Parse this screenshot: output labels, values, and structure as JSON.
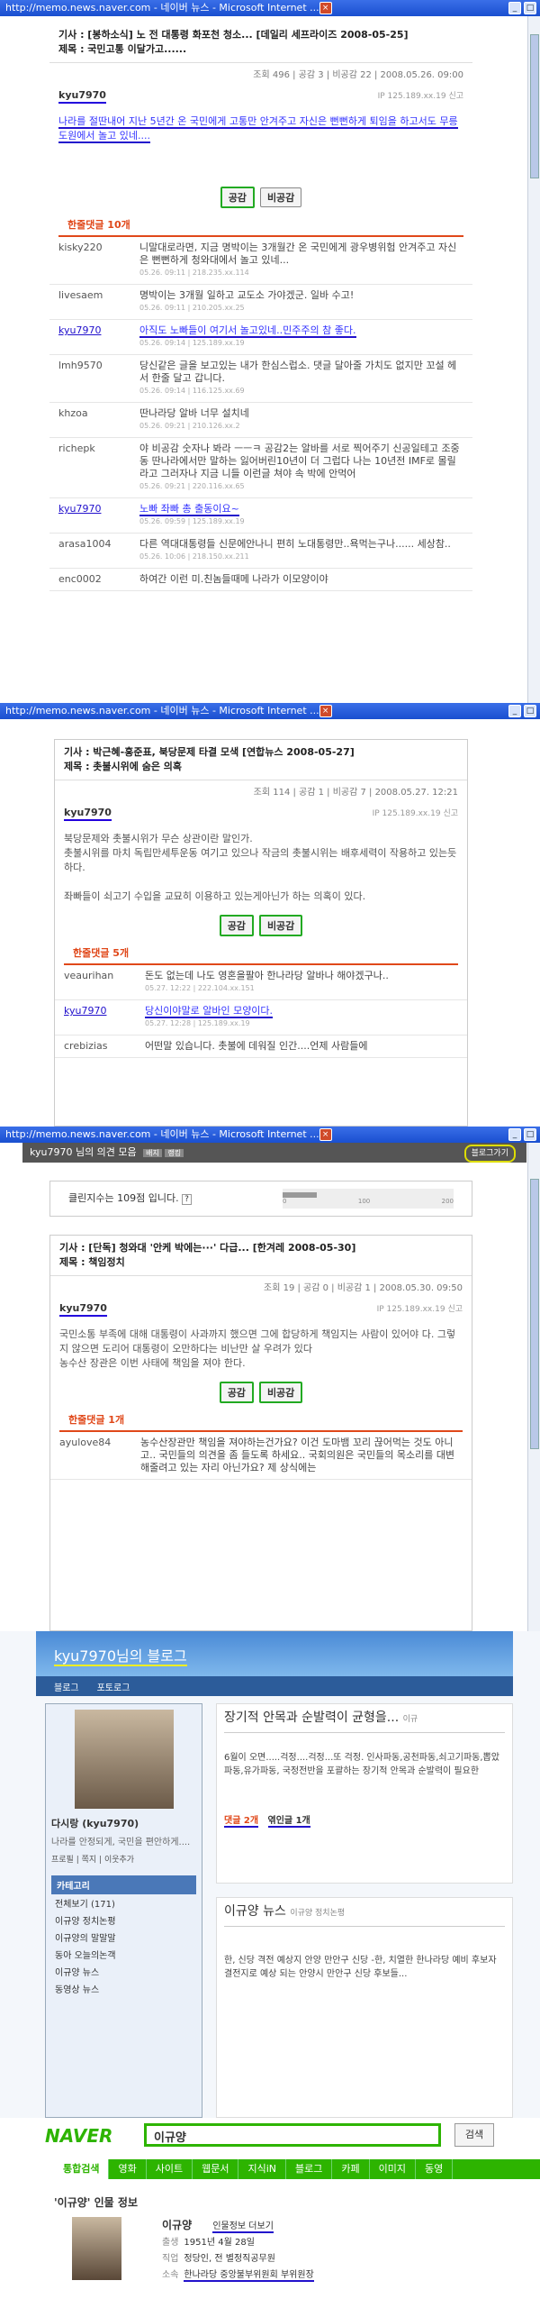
{
  "win1": {
    "title": "http://memo.news.naver.com - 네이버 뉴스 - Microsoft Internet ...",
    "article": "기사 : [봉하소식] 노 전 대통령 화포천 청소... [데일리 세프라이즈 2008-05-25]",
    "subject": "제목 : 국민고통 이달가고......",
    "stats": "조회 496 | 공감 3 | 비공감 22 | 2008.05.26. 09:00",
    "author": "kyu7970",
    "ip": "IP 125.189.xx.19",
    "report": "신고",
    "body": "나라를 절딴내어 지난 5년간 온 국민에게 고통만 안겨주고 자신은 뻔뻔하게 퇴임을 하고서도 무릉도원에서 놀고 있네....",
    "agree": "공감",
    "disagree": "비공감",
    "reply_head": "한줄댓글 10개",
    "replies": [
      {
        "nick": "kisky220",
        "text": "니말대로라면, 지금 명박이는 3개월간 온 국민에게 광우병위험 안겨주고 자신은 뻔뻔하게 청와대에서 놀고 있네...",
        "sub": "05.26. 09:11 | 218.235.xx.114"
      },
      {
        "nick": "livesaem",
        "text": "명박이는 3개월 일하고 교도소 가야겠군. 일바 수고!",
        "sub": "05.26. 09:11 | 210.205.xx.25"
      },
      {
        "nick": "kyu7970",
        "text": "아직도 노빠들이 여기서 놀고있네..민주주의 참 좋다.",
        "sub": "05.26. 09:14 | 125.189.xx.19"
      },
      {
        "nick": "lmh9570",
        "text": "당신같은 글을 보고있는 내가 한심스럽소. 댓글 달아줄 가치도 없지만 꼬설 헤서 한줄 달고 갑니다.",
        "sub": "05.26. 09:14 | 116.125.xx.69"
      },
      {
        "nick": "khzoa",
        "text": "딴나라당 알바 너무 설치네",
        "sub": "05.26. 09:21 | 210.126.xx.2"
      },
      {
        "nick": "richepk",
        "text": "야 비공감 숫자나 봐라 ㅡㅡㅋ 공감2는 알바를 서로 찍어주기 신공일테고 조중동 딴나라에서만 말하는 잃어버린10년이 더 그럽다 나는 10년전 IMF로 몰릴라고 그러자나 지금 니들 이런글 쳐야 속 박에 안먹어",
        "sub": "05.26. 09:21 | 220.116.xx.65"
      },
      {
        "nick": "kyu7970",
        "text": "노빠 좌빠 총 출동이요~",
        "sub": "05.26. 09:59 | 125.189.xx.19"
      },
      {
        "nick": "arasa1004",
        "text": "다른 역대대통령들 신문에안나니 편히 노대통령만..욕먹는구나...... 세상참..",
        "sub": "05.26. 10:06 | 218.150.xx.211"
      },
      {
        "nick": "enc0002",
        "text": "하여간 이런 미.친놈들때메 나라가 이모양이야",
        "sub": ""
      }
    ]
  },
  "win2": {
    "title": "http://memo.news.naver.com - 네이버 뉴스 - Microsoft Internet ...",
    "article": "기사 : 박근혜-홍준표, 북당문제 타결 모색 [연합뉴스 2008-05-27]",
    "subject": "제목 : 촛불시위에 숨은 의혹",
    "stats": "조회 114 | 공감 1 | 비공감 7 | 2008.05.27. 12:21",
    "author": "kyu7970",
    "ip": "IP 125.189.xx.19",
    "report": "신고",
    "body1": "북당문제와 촛불시위가 무슨 상관이란 말인가.",
    "body2": "촛불시위를 마치 독립만세투운동 여기고 있으나 작금의 촛불시위는 배후세력이 작용하고 있는듯하다.",
    "body3": "좌빠들이 쇠고기 수입을 교묘히 이용하고 있는게아닌가 하는 의혹이 있다.",
    "agree": "공감",
    "disagree": "비공감",
    "reply_head": "한줄댓글 5개",
    "replies": [
      {
        "nick": "veaurihan",
        "text": "돈도 없는데 나도 영혼을팔아 한나라당 알바나 해야겠구나..",
        "sub": "05.27. 12:22 | 222.104.xx.151"
      },
      {
        "nick": "kyu7970",
        "text": "당신이야말로 알바인 모양이다.",
        "sub": "05.27. 12:28 | 125.189.xx.19"
      },
      {
        "nick": "crebizias",
        "text": "어떤말 있습니다. 촛불에 데워질 인간....언제 사람들에",
        "sub": ""
      }
    ]
  },
  "win3": {
    "title": "http://memo.news.naver.com - 네이버 뉴스 - Microsoft Internet ...",
    "owner": "kyu7970 님의 의견 모음",
    "tag1": "배지",
    "tag2": "랭킹",
    "blog_btn": "블로그가기",
    "clean": "클린지수는 109점 입니다.",
    "help": "?",
    "scale": [
      "0",
      "100",
      "200"
    ],
    "clean_level": 0.2,
    "article": "기사 : [단독] 청와대 '안케 박에는···' 다급... [한겨레 2008-05-30]",
    "subject": "제목 : 책임정치",
    "stats": "조회 19 | 공감 0 | 비공감 1 | 2008.05.30. 09:50",
    "author": "kyu7970",
    "ip": "IP 125.189.xx.19",
    "report": "신고",
    "body1": "국민소통 부족에 대해 대통령이 사과까지 했으면 그에 합당하게 책임지는 사람이 있어야 다. 그렇지 않으면 도리어 대통령이 오만하다는 비난만 살 우려가 있다",
    "body2": "농수산 장관은 이번 사태에 책임을 져야 한다.",
    "agree": "공감",
    "disagree": "비공감",
    "reply_head": "한줄댓글 1개",
    "replies": [
      {
        "nick": "ayulove84",
        "text": "농수산장관만 책임을 져야하는건가요? 이건 도마뱀 꼬리 끊어먹는 것도 아니고.. 국민들의 의견을 좀 들도록 하세요.. 국회의원은 국민들의 목소리를 대변해줄려고 있는 자리 아닌가요? 제 상식에는",
        "sub": ""
      }
    ]
  },
  "blog": {
    "title": "kyu7970님의 블로그",
    "nav1": "블로그",
    "nav2": "포토로그",
    "name": "다시랑 (kyu7970)",
    "desc": "나라를 안정되게, 국민을 편안하게....",
    "links": [
      "프로필",
      "쪽지",
      "이웃추가"
    ],
    "category": "카테고리",
    "cats": [
      "전체보기 (171)",
      "이규양 정치논평",
      "이규양의 말말말",
      "동아 오늘의논객",
      "이규양 뉴스",
      "동영상 뉴스"
    ],
    "post_title": "장기적 안목과 순발력이 균형을...",
    "post_cat": "이규",
    "post_body": "6월이 오면.....걱정....걱정...또 걱정. 인사파동,공천파동,쇠고기파동,뽑았파동,유가파동, 국정전반을 포괄하는 장기적 안목과 순발력이 필요한",
    "comment": "댓글 2개",
    "trackback": "엮인글 1개",
    "news_title": "이규양 뉴스",
    "news_cat": "이규양 정치논평",
    "news_body": "한, 신당 격전 예상지 안양 만안구 신당 -한, 치열한 한나라당 예비 후보자 결전지로 예상 되는 안양시 만안구 신당 후보들..."
  },
  "naver": {
    "logo": "NAVER",
    "query": "이규양",
    "search": "검색",
    "tabs": [
      "통합검색",
      "영화",
      "사이트",
      "웹문서",
      "지식iN",
      "블로그",
      "카페",
      "이미지",
      "동영"
    ],
    "people": "'이규양' 인물 정보",
    "person": "이규양",
    "more": "인물정보 더보기",
    "born_label": "출생",
    "born": "1951년 4월 28일",
    "job_label": "직업",
    "job": "정당인, 전 별정직공무원",
    "org_label": "소속",
    "org": "한나라당 중앙불부위원회 부위원장"
  }
}
